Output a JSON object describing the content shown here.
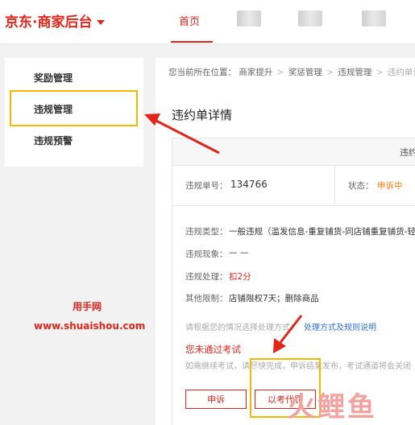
{
  "header": {
    "brand": "京东·商家后台",
    "nav_home": "首页"
  },
  "sidebar": {
    "items": [
      {
        "label": "奖励管理"
      },
      {
        "label": "违规管理"
      },
      {
        "label": "违规预警"
      }
    ]
  },
  "breadcrumb": {
    "prefix": "您当前所在位置：",
    "items": [
      "商家提升",
      "奖惩管理",
      "违规管理"
    ],
    "current": "违约单详情",
    "separator": ">"
  },
  "page_title": "违约单详情",
  "card": {
    "header_text": "违约",
    "order_label": "违规单号：",
    "order_value": "134766",
    "status_label": "状态：",
    "status_value": "申诉中",
    "type_label": "违规类型：",
    "type_value": "一般违规（滥发信息-重复铺货-同店铺重复铺货-轻",
    "phenomenon_label": "违规现象：",
    "phenomenon_value": "— —",
    "handling_label": "违规处理：",
    "handling_value": "扣2分",
    "other_label": "其他限制：",
    "other_value": "店铺限权7天；删除商品",
    "hint_text": "请根据您的情况选择处理方式：",
    "hint_link": "处理方式及规则说明",
    "exam_title": "您未通过考试",
    "exam_desc": "如需继续考试，请尽快完成，申诉结果发布，考试通道将会关闭",
    "appeal_button": "申诉",
    "exam_button": "以考代罚"
  },
  "watermark": {
    "name": "用手网",
    "url": "www.shuaishou.com",
    "corner_logo": "火鲤鱼"
  },
  "colors": {
    "brand_red": "#e1251b",
    "highlight_yellow": "#f5b800",
    "status_orange": "#ff7a00",
    "link_blue": "#2f6fd6"
  }
}
